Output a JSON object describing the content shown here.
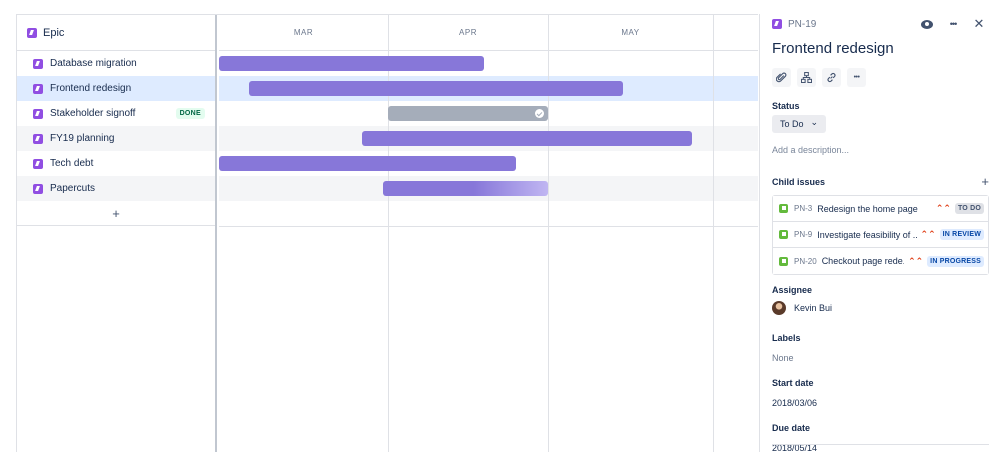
{
  "roadmap": {
    "epic_header": "Epic",
    "months": [
      "MAR",
      "APR",
      "MAY"
    ],
    "add_label": "+",
    "epics": [
      {
        "name": "Database migration",
        "status": "",
        "bar": "active"
      },
      {
        "name": "Frontend redesign",
        "status": "",
        "bar": "active"
      },
      {
        "name": "Stakeholder signoff",
        "status": "DONE",
        "bar": "done"
      },
      {
        "name": "FY19 planning",
        "status": "",
        "bar": "active"
      },
      {
        "name": "Tech debt",
        "status": "",
        "bar": "active"
      },
      {
        "name": "Papercuts",
        "status": "",
        "bar": "active"
      }
    ]
  },
  "panel": {
    "issue_key": "PN-19",
    "title": "Frontend redesign",
    "watch_icon": "eye-icon",
    "more_label": "•••",
    "close_label": "✕",
    "actions": [
      {
        "icon": "attachment-icon",
        "glyph": "📎"
      },
      {
        "icon": "child-issue-icon",
        "glyph": "⛓"
      },
      {
        "icon": "link-icon",
        "glyph": "🔗"
      },
      {
        "icon": "more-icon",
        "glyph": "•••"
      }
    ],
    "status_label": "Status",
    "status_value": "To Do",
    "status_chevron": "⌄",
    "description_placeholder": "Add a description...",
    "child_issues_label": "Child issues",
    "child_add": "+",
    "child_issues": [
      {
        "key": "PN-3",
        "title": "Redesign the home page",
        "priority": "⌃⌃",
        "status": "TO DO"
      },
      {
        "key": "PN-9",
        "title": "Investigate feasibility of ...",
        "priority": "⌃⌃",
        "status": "IN REVIEW"
      },
      {
        "key": "PN-20",
        "title": "Checkout page rede...",
        "priority": "⌃⌃",
        "status": "IN PROGRESS"
      }
    ],
    "assignee_label": "Assignee",
    "assignee_name": "Kevin Bui",
    "labels_label": "Labels",
    "labels_value": "None",
    "start_date_label": "Start date",
    "start_date_value": "2018/03/06",
    "due_date_label": "Due date",
    "due_date_value": "2018/05/14"
  },
  "colors": {
    "epic": "#904EE2",
    "bar": "#8777D9",
    "bar_done": "#A5ADBA",
    "story": "#63BA3C",
    "priority": "#DE350B",
    "selected_row": "#DEEBFF"
  }
}
